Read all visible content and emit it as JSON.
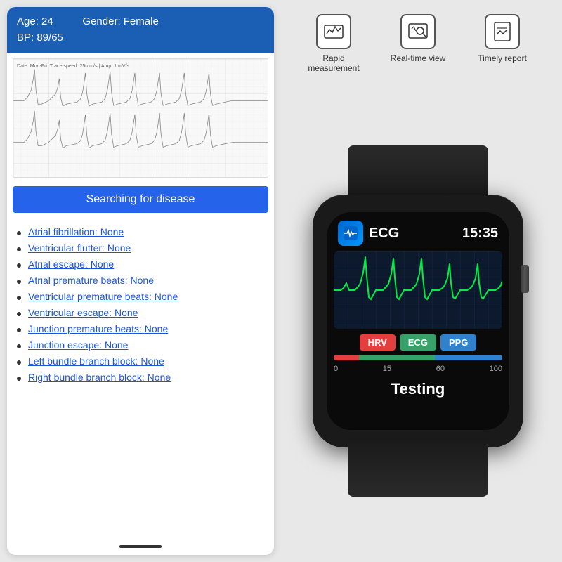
{
  "patient": {
    "age_label": "Age: 24",
    "gender_label": "Gender: Female",
    "bp_label": "BP: 89/65"
  },
  "search_banner": "Searching for disease",
  "diseases": [
    {
      "name": "Atrial fibrillation:",
      "value": "None"
    },
    {
      "name": "Ventricular flutter:",
      "value": "None"
    },
    {
      "name": "Atrial escape:",
      "value": "None"
    },
    {
      "name": "Atrial premature beats:",
      "value": "None"
    },
    {
      "name": "Ventricular premature beats:",
      "value": "None"
    },
    {
      "name": "Ventricular escape:",
      "value": "None"
    },
    {
      "name": "Junction premature beats:",
      "value": "None"
    },
    {
      "name": "Junction escape:",
      "value": "None"
    },
    {
      "name": "Left bundle branch block:",
      "value": "None"
    },
    {
      "name": "Right bundle branch block:",
      "value": "None"
    }
  ],
  "features": [
    {
      "id": "rapid",
      "label": "Rapid measurement",
      "icon": "📈"
    },
    {
      "id": "realtime",
      "label": "Real-time view",
      "icon": "🔍"
    },
    {
      "id": "timely",
      "label": "Timely report",
      "icon": "📋"
    }
  ],
  "watch": {
    "app_name": "ECG",
    "time": "15:35",
    "metrics": {
      "hrv": "HRV",
      "ecg": "ECG",
      "ppg": "PPG"
    },
    "progress_labels": [
      "0",
      "15",
      "60",
      "100"
    ],
    "status": "Testing"
  }
}
